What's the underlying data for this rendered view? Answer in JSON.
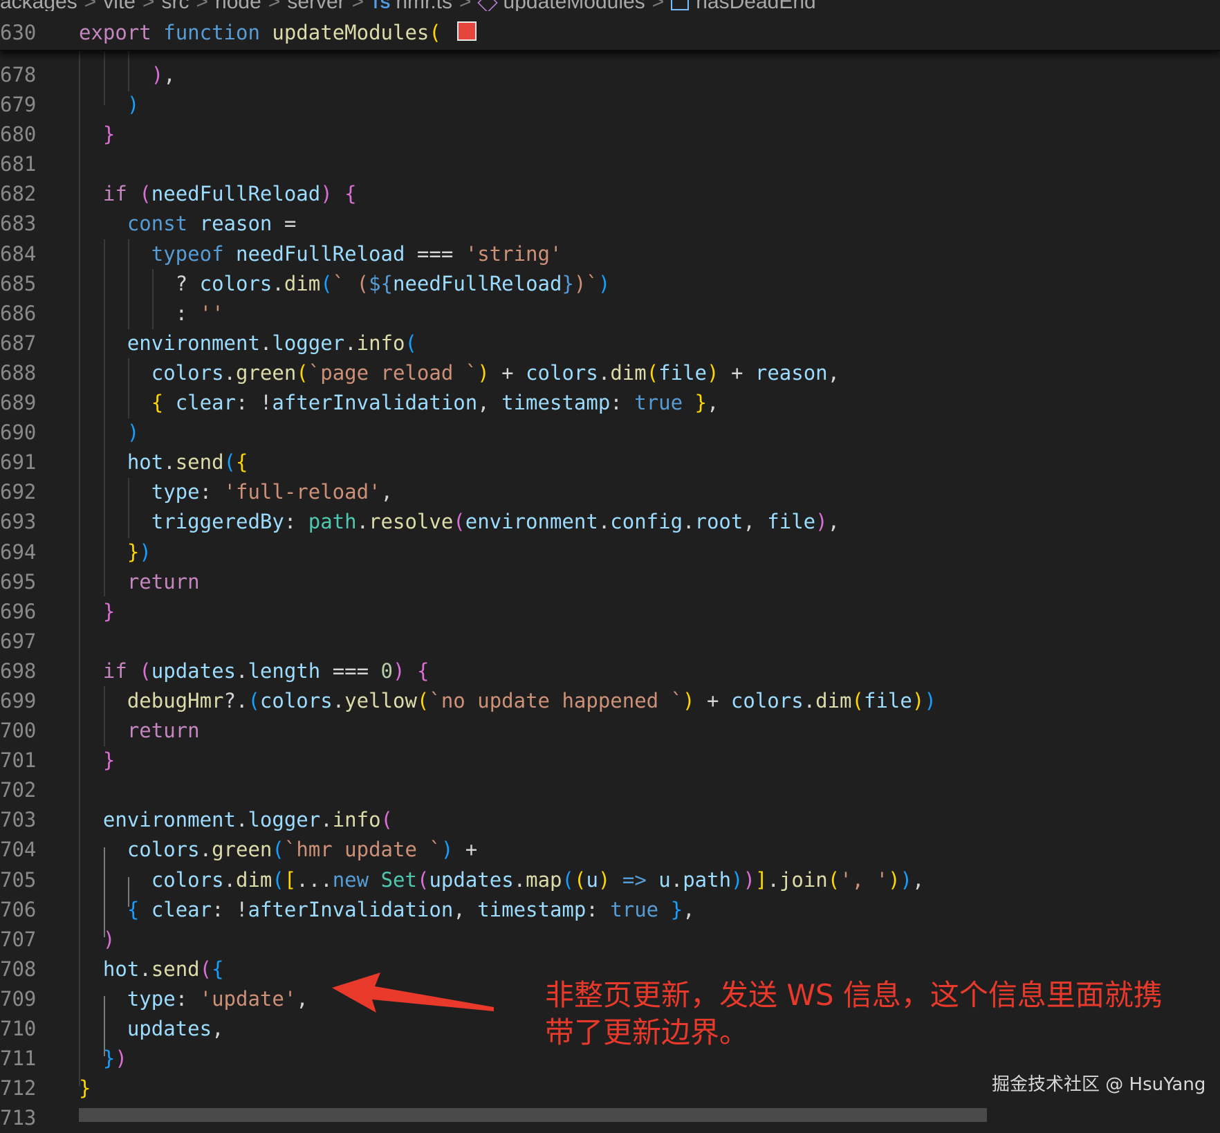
{
  "breadcrumb": {
    "items": [
      "ackages",
      "vite",
      "src",
      "node",
      "server"
    ],
    "ts_badge": "TS",
    "file": "hmr.ts",
    "symbol_function": "updateModules",
    "symbol_variable": "hasDeadEnd",
    "separator": ">"
  },
  "sticky_header": {
    "line_number": "630",
    "keyword_export": "export",
    "keyword_function": "function",
    "function_name": "updateModules",
    "open_paren": "("
  },
  "line_numbers": [
    "678",
    "679",
    "680",
    "681",
    "682",
    "683",
    "684",
    "685",
    "686",
    "687",
    "688",
    "689",
    "690",
    "691",
    "692",
    "693",
    "694",
    "695",
    "696",
    "697",
    "698",
    "699",
    "700",
    "701",
    "702",
    "703",
    "704",
    "705",
    "706",
    "707",
    "708",
    "709",
    "710",
    "711",
    "712",
    "713"
  ],
  "annotation": {
    "text_line1": "非整页更新，发送 WS 信息，这个信息里面就携",
    "text_line2": "带了更新边界。",
    "color": "#e8392b"
  },
  "watermark": "掘金技术社区 @ HsuYang",
  "colors": {
    "background": "#1f1f1f",
    "keyword": "#c586c0",
    "storage": "#569cd6",
    "function": "#dcdcaa",
    "variable": "#9cdcfe",
    "string": "#ce9178",
    "class": "#4ec9b0"
  }
}
